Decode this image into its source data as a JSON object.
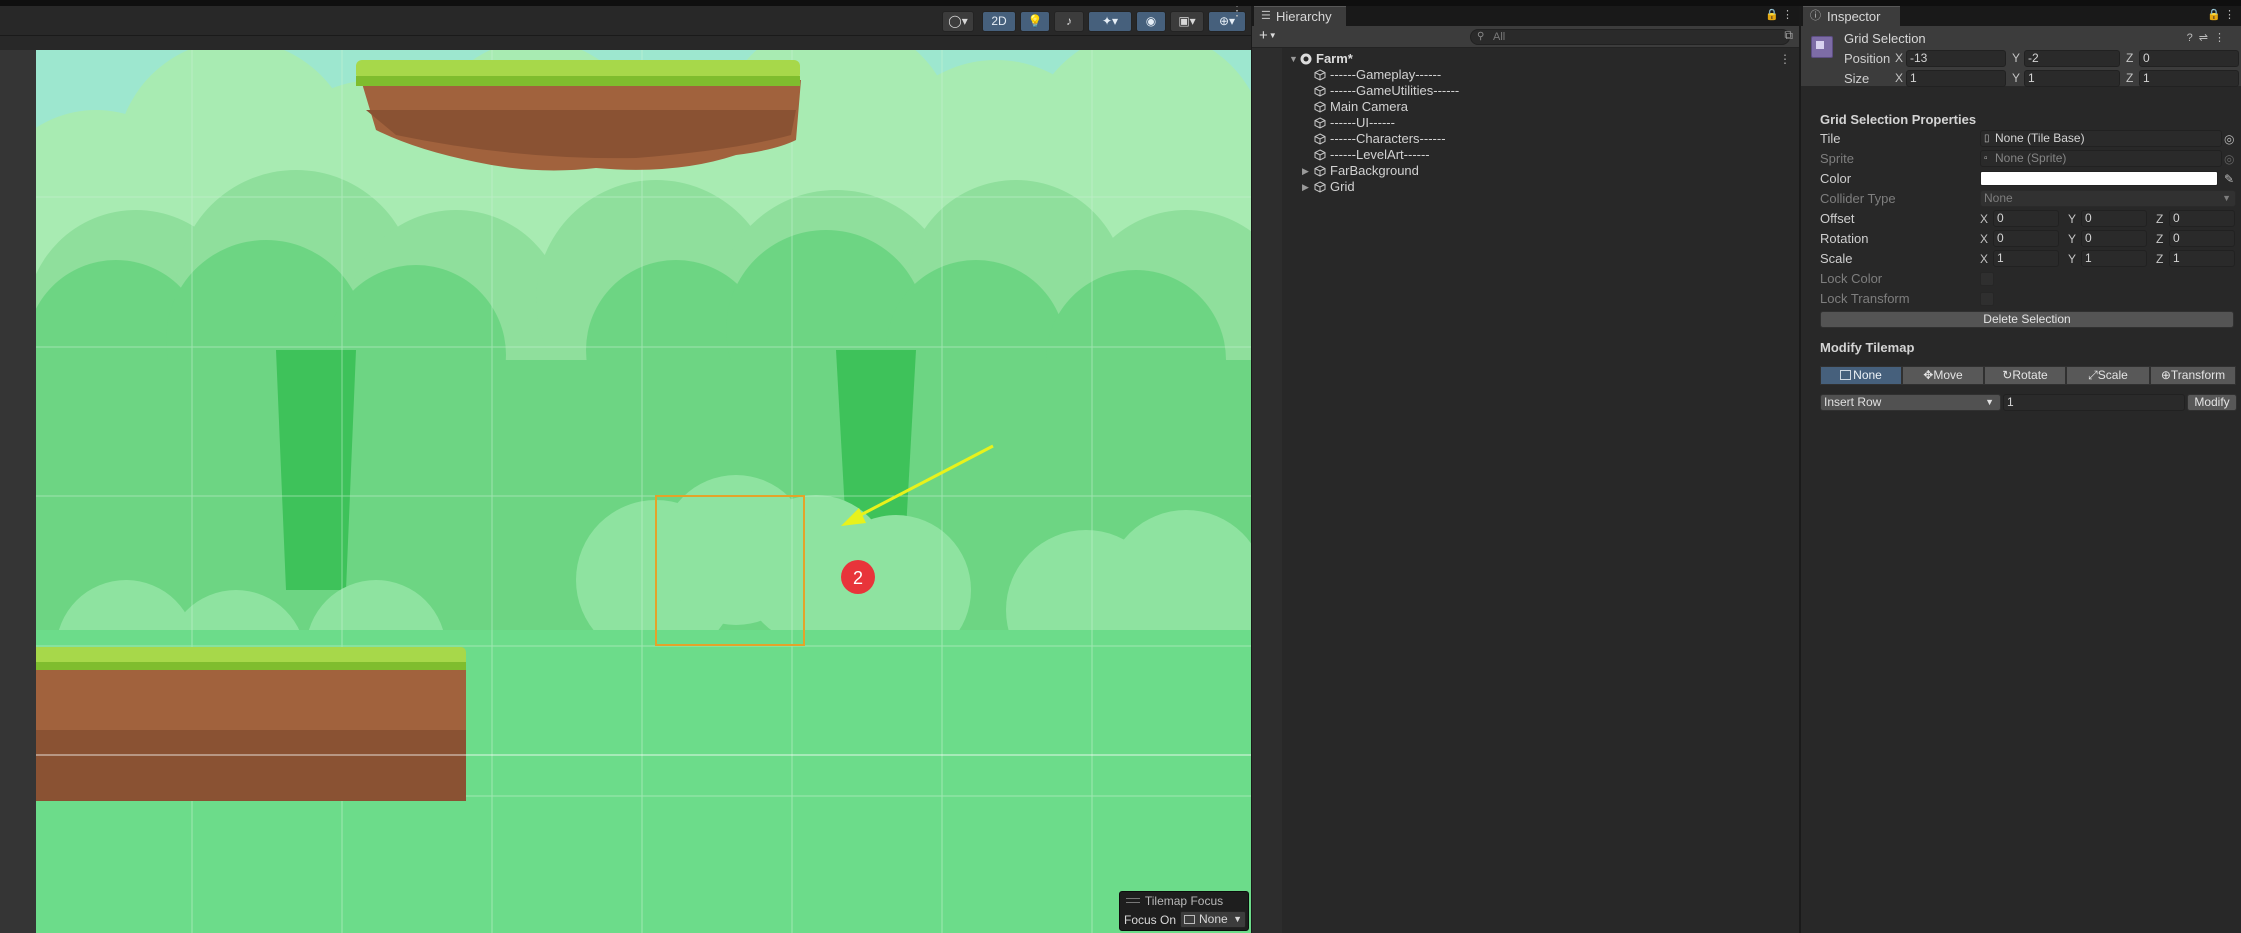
{
  "scene": {
    "toolbar": {
      "mode_2d": "2D"
    },
    "badge_number": "2",
    "overlay": {
      "title": "Tilemap Focus",
      "focus_label": "Focus On",
      "focus_value": "None"
    }
  },
  "hierarchy": {
    "tab_label": "Hierarchy",
    "search_placeholder": "All",
    "scene_name": "Farm*",
    "items": [
      {
        "label": "------Gameplay------",
        "expandable": false
      },
      {
        "label": "------GameUtilities------",
        "expandable": false
      },
      {
        "label": "Main Camera",
        "expandable": false
      },
      {
        "label": "------UI------",
        "expandable": false
      },
      {
        "label": "------Characters------",
        "expandable": false
      },
      {
        "label": "------LevelArt------",
        "expandable": false
      },
      {
        "label": "FarBackground",
        "expandable": true
      },
      {
        "label": "Grid",
        "expandable": true
      }
    ]
  },
  "inspector": {
    "tab_label": "Inspector",
    "header": {
      "title": "Grid Selection",
      "position_label": "Position",
      "size_label": "Size",
      "position": {
        "x": "-13",
        "y": "-2",
        "z": "0"
      },
      "size": {
        "x": "1",
        "y": "1",
        "z": "1"
      }
    },
    "axis": {
      "x": "X",
      "y": "Y",
      "z": "Z"
    },
    "props_title": "Grid Selection Properties",
    "props": {
      "tile_label": "Tile",
      "tile_value": "None (Tile Base)",
      "sprite_label": "Sprite",
      "sprite_value": "None (Sprite)",
      "color_label": "Color",
      "color_value": "#ffffff",
      "collider_label": "Collider Type",
      "collider_value": "None",
      "offset_label": "Offset",
      "offset": {
        "x": "0",
        "y": "0",
        "z": "0"
      },
      "rotation_label": "Rotation",
      "rotation": {
        "x": "0",
        "y": "0",
        "z": "0"
      },
      "scale_label": "Scale",
      "scale": {
        "x": "1",
        "y": "1",
        "z": "1"
      },
      "lock_color_label": "Lock Color",
      "lock_transform_label": "Lock Transform",
      "delete_button": "Delete Selection"
    },
    "modify": {
      "title": "Modify Tilemap",
      "tools": [
        "None",
        "Move",
        "Rotate",
        "Scale",
        "Transform"
      ],
      "selected_tool": "None",
      "row_mode": "Insert Row",
      "count": "1",
      "modify_button": "Modify"
    }
  }
}
